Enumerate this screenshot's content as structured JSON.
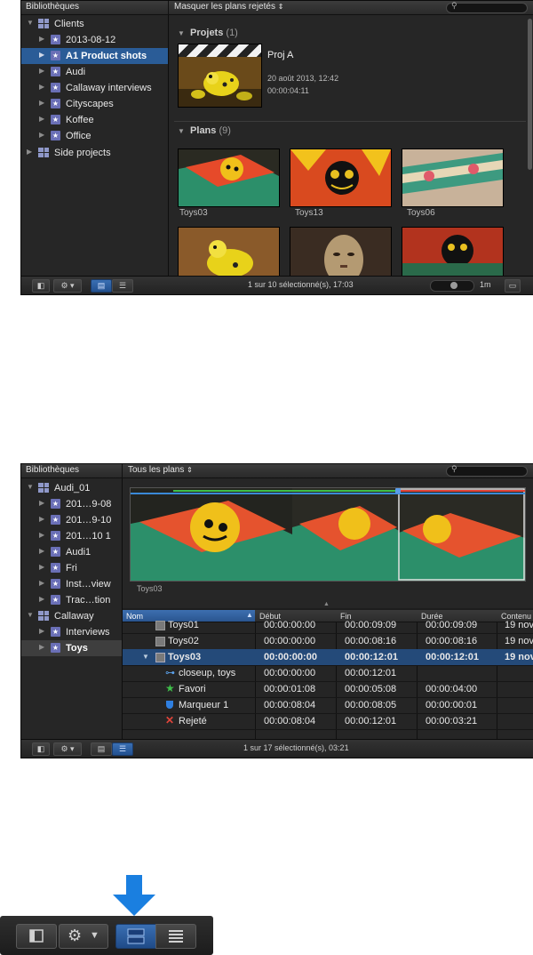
{
  "panel1": {
    "library_label": "Bibliothèques",
    "filter_label": "Masquer les plans rejetés",
    "filter_arrows": "⇕",
    "sidebar": [
      {
        "label": "Clients",
        "kind": "library",
        "expanded": true
      },
      {
        "label": "2013-08-12",
        "kind": "event"
      },
      {
        "label": "A1 Product shots",
        "kind": "event",
        "selected": true
      },
      {
        "label": "Audi",
        "kind": "event"
      },
      {
        "label": "Callaway interviews",
        "kind": "event"
      },
      {
        "label": "Cityscapes",
        "kind": "event"
      },
      {
        "label": "Koffee",
        "kind": "event"
      },
      {
        "label": "Office",
        "kind": "event"
      },
      {
        "label": "Side projects",
        "kind": "library",
        "expanded": false
      }
    ],
    "projects": {
      "heading": "Projets",
      "count": "(1)",
      "items": [
        {
          "name": "Proj A",
          "date": "20 août 2013, 12:42",
          "duration": "00:00:04:11"
        }
      ]
    },
    "clips": {
      "heading": "Plans",
      "count": "(9)",
      "items": [
        {
          "name": "Toys03"
        },
        {
          "name": "Toys13"
        },
        {
          "name": "Toys06"
        },
        {
          "name": ""
        },
        {
          "name": ""
        },
        {
          "name": ""
        }
      ]
    },
    "status": "1 sur 10 sélectionné(s), 17:03",
    "zoom_label": "1m"
  },
  "panel2": {
    "library_label": "Bibliothèques",
    "filter_label": "Tous les plans",
    "filter_arrows": "⇕",
    "sidebar": [
      {
        "label": "Audi_01",
        "kind": "library",
        "expanded": true
      },
      {
        "label": "201…9-08",
        "kind": "event"
      },
      {
        "label": "201…9-10",
        "kind": "event"
      },
      {
        "label": "201…10 1",
        "kind": "event"
      },
      {
        "label": "Audi1",
        "kind": "event"
      },
      {
        "label": "Fri",
        "kind": "event"
      },
      {
        "label": "Inst…view",
        "kind": "event"
      },
      {
        "label": "Trac…tion",
        "kind": "event"
      },
      {
        "label": "Callaway",
        "kind": "library",
        "expanded": true
      },
      {
        "label": "Interviews",
        "kind": "event"
      },
      {
        "label": "Toys",
        "kind": "event",
        "selected": true
      }
    ],
    "filmstrip_caption": "Toys03",
    "columns": [
      "Nom",
      "Début",
      "Fin",
      "Durée",
      "Contenu"
    ],
    "rows": [
      {
        "name": "Toys01",
        "start": "00:00:00:00",
        "end": "00:00:09:09",
        "dur": "00:00:09:09",
        "content": "19 nov",
        "icon": "clip"
      },
      {
        "name": "Toys02",
        "start": "00:00:00:00",
        "end": "00:00:08:16",
        "dur": "00:00:08:16",
        "content": "19 nov",
        "icon": "clip"
      },
      {
        "name": "Toys03",
        "start": "00:00:00:00",
        "end": "00:00:12:01",
        "dur": "00:00:12:01",
        "content": "19 nov",
        "icon": "clip",
        "selected": true,
        "expanded": true
      },
      {
        "name": "closeup, toys",
        "start": "00:00:00:00",
        "end": "00:00:12:01",
        "dur": "",
        "content": "",
        "icon": "keyword",
        "child": true
      },
      {
        "name": "Favori",
        "start": "00:00:01:08",
        "end": "00:00:05:08",
        "dur": "00:00:04:00",
        "content": "",
        "icon": "favorite",
        "child": true
      },
      {
        "name": "Marqueur 1",
        "start": "00:00:08:04",
        "end": "00:00:08:05",
        "dur": "00:00:00:01",
        "content": "",
        "icon": "marker",
        "child": true
      },
      {
        "name": "Rejeté",
        "start": "00:00:08:04",
        "end": "00:00:12:01",
        "dur": "00:00:03:21",
        "content": "",
        "icon": "rejected",
        "child": true
      }
    ],
    "status": "1 sur 17 sélectionné(s), 03:21"
  },
  "colors": {
    "selection": "#2a5c97",
    "accent_blue": "#1a7fe0",
    "favorite_green": "#3fbf4a",
    "reject_red": "#e0443a"
  }
}
